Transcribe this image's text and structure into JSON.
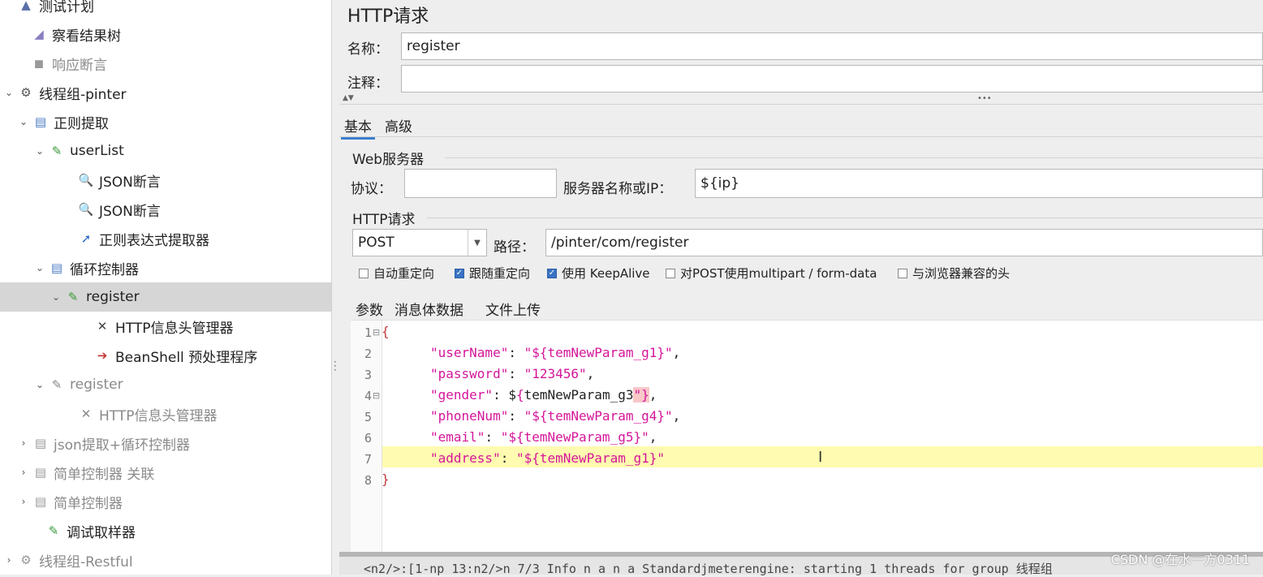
{
  "tree": {
    "items": [
      {
        "label": "测试计划",
        "icon": "flask-icon",
        "glyph": "▲",
        "color": "#5a6fa8",
        "indent": 4,
        "chevron": "",
        "disabled": false,
        "selected": false
      },
      {
        "label": "察看结果树",
        "icon": "chart-icon",
        "glyph": "◢",
        "color": "#8a7fc0",
        "indent": 20,
        "chevron": "",
        "disabled": false,
        "selected": false
      },
      {
        "label": "响应断言",
        "icon": "assertion-icon",
        "glyph": "◼",
        "color": "#9a9a9a",
        "indent": 20,
        "chevron": "",
        "disabled": true,
        "selected": false
      },
      {
        "label": "线程组-pinter",
        "icon": "gear-icon",
        "glyph": "⚙",
        "color": "#555",
        "indent": 4,
        "chevron": "⌄",
        "disabled": false,
        "selected": false
      },
      {
        "label": "正则提取",
        "icon": "controller-icon",
        "glyph": "▤",
        "color": "#4a7bc4",
        "indent": 22,
        "chevron": "⌄",
        "disabled": false,
        "selected": false
      },
      {
        "label": "userList",
        "icon": "pipette-icon",
        "glyph": "✎",
        "color": "#3a9a3a",
        "indent": 42,
        "chevron": "⌄",
        "disabled": false,
        "selected": false
      },
      {
        "label": "JSON断言",
        "icon": "magnifier-icon",
        "glyph": "🔍",
        "color": "#3a6fc4",
        "indent": 78,
        "chevron": "",
        "disabled": false,
        "selected": false
      },
      {
        "label": "JSON断言",
        "icon": "magnifier-icon",
        "glyph": "🔍",
        "color": "#3a6fc4",
        "indent": 78,
        "chevron": "",
        "disabled": false,
        "selected": false
      },
      {
        "label": "正则表达式提取器",
        "icon": "extractor-icon",
        "glyph": "➚",
        "color": "#2a6ac4",
        "indent": 78,
        "chevron": "",
        "disabled": false,
        "selected": false
      },
      {
        "label": "循环控制器",
        "icon": "controller-icon",
        "glyph": "▤",
        "color": "#4a7bc4",
        "indent": 42,
        "chevron": "⌄",
        "disabled": false,
        "selected": false
      },
      {
        "label": "register",
        "icon": "pipette-icon",
        "glyph": "✎",
        "color": "#3a9a3a",
        "indent": 62,
        "chevron": "⌄",
        "disabled": false,
        "selected": true
      },
      {
        "label": "HTTP信息头管理器",
        "icon": "wrench-icon",
        "glyph": "✕",
        "color": "#444",
        "indent": 98,
        "chevron": "",
        "disabled": false,
        "selected": false
      },
      {
        "label": "BeanShell 预处理程序",
        "icon": "preprocessor-icon",
        "glyph": "➔",
        "color": "#c43a3a",
        "indent": 98,
        "chevron": "",
        "disabled": false,
        "selected": false
      },
      {
        "label": "register",
        "icon": "pipette-icon",
        "glyph": "✎",
        "color": "#888",
        "indent": 42,
        "chevron": "⌄",
        "disabled": true,
        "selected": false
      },
      {
        "label": "HTTP信息头管理器",
        "icon": "wrench-icon",
        "glyph": "✕",
        "color": "#888",
        "indent": 78,
        "chevron": "",
        "disabled": true,
        "selected": false
      },
      {
        "label": "json提取+循环控制器",
        "icon": "controller-icon",
        "glyph": "▤",
        "color": "#999",
        "indent": 22,
        "chevron": "›",
        "disabled": true,
        "selected": false
      },
      {
        "label": "简单控制器 关联",
        "icon": "controller-icon",
        "glyph": "▤",
        "color": "#999",
        "indent": 22,
        "chevron": "›",
        "disabled": true,
        "selected": false
      },
      {
        "label": "简单控制器",
        "icon": "controller-icon",
        "glyph": "▤",
        "color": "#999",
        "indent": 22,
        "chevron": "›",
        "disabled": true,
        "selected": false
      },
      {
        "label": "调试取样器",
        "icon": "pipette-icon",
        "glyph": "✎",
        "color": "#3a9a3a",
        "indent": 38,
        "chevron": "",
        "disabled": false,
        "selected": false
      },
      {
        "label": "线程组-Restful",
        "icon": "gear-icon",
        "glyph": "⚙",
        "color": "#999",
        "indent": 4,
        "chevron": "›",
        "disabled": true,
        "selected": false
      }
    ]
  },
  "panel": {
    "title": "HTTP请求",
    "name_label": "名称：",
    "name_value": "register",
    "comment_label": "注释：",
    "comment_value": "",
    "tabs": [
      "基本",
      "高级"
    ],
    "web_server_section": "Web服务器",
    "protocol_label": "协议：",
    "protocol_value": "",
    "server_label": "服务器名称或IP：",
    "server_value": "${ip}",
    "http_section": "HTTP请求",
    "method_value": "POST",
    "path_label": "路径：",
    "path_value": "/pinter/com/register",
    "checkboxes": [
      {
        "label": "自动重定向",
        "checked": false
      },
      {
        "label": "跟随重定向",
        "checked": true
      },
      {
        "label": "使用 KeepAlive",
        "checked": true
      },
      {
        "label": "对POST使用multipart / form-data",
        "checked": false
      },
      {
        "label": "与浏览器兼容的头",
        "checked": false
      }
    ],
    "sub_tabs": [
      "参数",
      "消息体数据",
      "文件上传"
    ],
    "active_sub_tab": 1
  },
  "editor": {
    "lines": [
      {
        "n": "1",
        "fold": "⊟"
      },
      {
        "n": "2",
        "fold": ""
      },
      {
        "n": "3",
        "fold": ""
      },
      {
        "n": "4",
        "fold": "⊟"
      },
      {
        "n": "5",
        "fold": ""
      },
      {
        "n": "6",
        "fold": ""
      },
      {
        "n": "7",
        "fold": ""
      },
      {
        "n": "8",
        "fold": ""
      }
    ],
    "code": {
      "l1_brace": "{",
      "l2_key": "\"userName\"",
      "l2_sep": ": ",
      "l2_val": "\"${temNewParam_g1}\"",
      "l2_end": ",",
      "l3_key": "\"password\"",
      "l3_sep": ": ",
      "l3_val": "\"123456\"",
      "l3_end": ",",
      "l4_key": "\"gender\"",
      "l4_sep": ": ",
      "l4_pre": "$",
      "l4_brace": "{",
      "l4_mid": "temNewParam_g3",
      "l4_bad": "\"}",
      "l4_end": ",",
      "l5_key": "\"phoneNum\"",
      "l5_sep": ": ",
      "l5_val": "\"${temNewParam_g4}\"",
      "l5_end": ",",
      "l6_key": "\"email\"",
      "l6_sep": ": ",
      "l6_val": "\"${temNewParam_g5}\"",
      "l6_end": ",",
      "l7_key": "\"address\"",
      "l7_sep": ": ",
      "l7_val": "\"${temNewParam_g1}\"",
      "l8_brace": "}"
    }
  },
  "bottom_log": "<n2/>:[1-np 13:n2/>n 7/3 Info n a n a Standardjmeterengine: starting 1 threads for group 线程组",
  "watermark": "CSDN @在水一方0311"
}
